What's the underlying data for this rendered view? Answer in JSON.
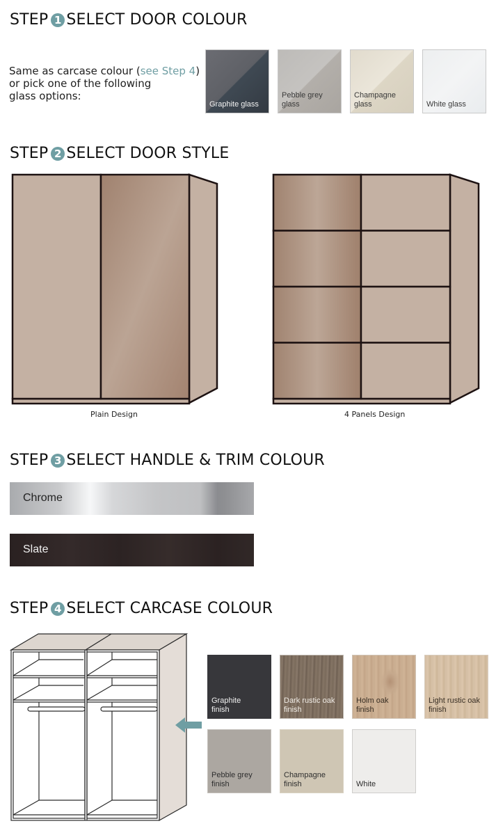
{
  "step1": {
    "prefix": "STEP",
    "number": "1",
    "title": "SELECT DOOR COLOUR",
    "intro_before": "Same as carcase colour (",
    "intro_link": "see Step 4",
    "intro_after": ")",
    "intro_line2": "or pick one of the following",
    "intro_line3": "glass options:",
    "swatches": [
      {
        "line1": "Graphite glass",
        "line2": "",
        "color": "#4d5158"
      },
      {
        "line1": "Pebble grey",
        "line2": "glass",
        "color": "#b7b4b0"
      },
      {
        "line1": "Champagne",
        "line2": "glass",
        "color": "#e2dccd"
      },
      {
        "line1": "White glass",
        "line2": "",
        "color": "#eef0f1"
      }
    ]
  },
  "step2": {
    "prefix": "STEP",
    "number": "2",
    "title": "SELECT DOOR STYLE",
    "designs": [
      {
        "label": "Plain Design"
      },
      {
        "label": "4 Panels Design"
      }
    ]
  },
  "step3": {
    "prefix": "STEP",
    "number": "3",
    "title": "SELECT HANDLE & TRIM COLOUR",
    "options": [
      {
        "label": "Chrome"
      },
      {
        "label": "Slate"
      }
    ]
  },
  "step4": {
    "prefix": "STEP",
    "number": "4",
    "title": "SELECT CARCASE COLOUR",
    "swatches": [
      {
        "line1": "Graphite",
        "line2": "finish",
        "color": "#37373b"
      },
      {
        "line1": "Dark rustic oak",
        "line2": "finish",
        "color": "#7d6d5e"
      },
      {
        "line1": "Holm oak",
        "line2": "finish",
        "color": "#c7aa8c"
      },
      {
        "line1": "Light rustic oak",
        "line2": "finish",
        "color": "#d3bda3"
      },
      {
        "line1": "Pebble grey",
        "line2": "finish",
        "color": "#aca7a1"
      },
      {
        "line1": "Champagne",
        "line2": "finish",
        "color": "#cfc6b4"
      },
      {
        "line1": "White",
        "line2": "",
        "color": "#eeedeb"
      }
    ]
  },
  "colors": {
    "accent": "#6f9ea3",
    "door_base": "#c4b1a3",
    "door_gloss": "#a88775",
    "outline": "#1d1212"
  }
}
